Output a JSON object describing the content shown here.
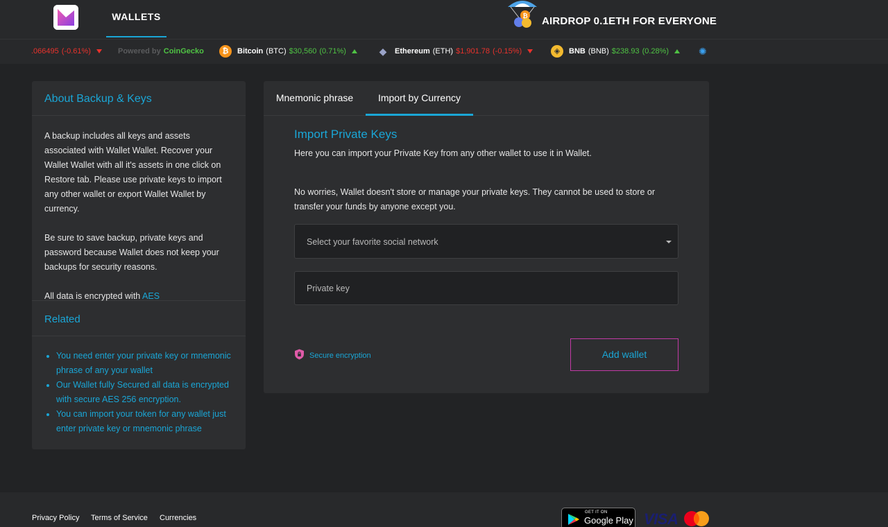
{
  "header": {
    "nav_wallets": "WALLETS",
    "airdrop": "AIRDROP 0.1ETH FOR EVERYONE"
  },
  "ticker": {
    "partial_price": ".066495",
    "partial_change": "(-0.61%)",
    "powered_prefix": "Powered by",
    "powered_brand": "CoinGecko",
    "coins": [
      {
        "name": "Bitcoin",
        "symbol": "(BTC)",
        "price": "$30,560",
        "change": "(0.71%)",
        "trend": "up",
        "color": "#f7931a"
      },
      {
        "name": "Ethereum",
        "symbol": "(ETH)",
        "price": "$1,901.78",
        "change": "(-0.15%)",
        "trend": "down",
        "color": "#627eea"
      },
      {
        "name": "BNB",
        "symbol": "(BNB)",
        "price": "$238.93",
        "change": "(0.28%)",
        "trend": "up",
        "color": "#f3ba2f"
      }
    ]
  },
  "left_panel": {
    "title": "About Backup & Keys",
    "para1": "A backup includes all keys and assets associated with Wallet Wallet. Recover your Wallet Wallet with all it's assets in one click on Restore tab. Please use private keys to import any other wallet or export Wallet Wallet by currency.",
    "para2": "Be sure to save backup, private keys and password because Wallet does not keep your backups for security reasons.",
    "para3_prefix": "All data is encrypted with ",
    "para3_link": "AES",
    "related_title": "Related",
    "related_items": [
      "You need enter your private key or mnemonic phrase of any your wallet",
      "Our Wallet fully Secured all data is encrypted with secure AES 256 encryption.",
      "You can import your token for any wallet just enter private key or mnemonic phrase"
    ]
  },
  "right_panel": {
    "tabs": [
      "Mnemonic phrase",
      "Import by Currency"
    ],
    "active_tab": "Import by Currency",
    "title": "Import Private Keys",
    "subtitle": "Here you can import your Private Key from any other wallet to use it in Wallet.",
    "note": "No worries, Wallet doesn't store or manage your private keys. They cannot be used to store or transfer your funds by anyone except you.",
    "select_placeholder": "Select your favorite social network",
    "private_key_placeholder": "Private key",
    "secure_label": "Secure encryption",
    "add_button": "Add wallet"
  },
  "footer": {
    "links": [
      "Privacy Policy",
      "Terms of Service",
      "Currencies"
    ],
    "gplay_small": "GET IT ON",
    "gplay_big": "Google Play",
    "visa": "VISA"
  },
  "colors": {
    "accent": "#1aa6d6",
    "button_border": "#c23aa6",
    "background": "#222325",
    "panel": "#2d2e30"
  }
}
